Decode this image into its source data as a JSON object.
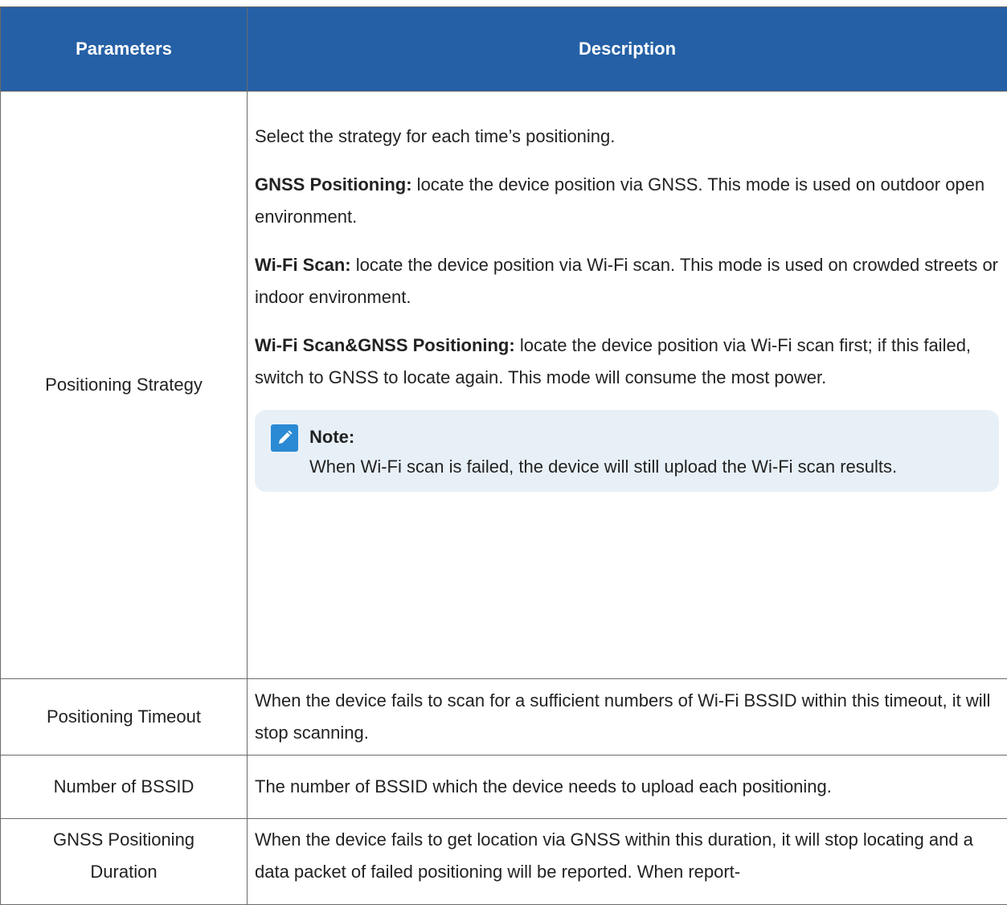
{
  "table": {
    "headers": {
      "parameters": "Parameters",
      "description": "Description"
    },
    "rows": {
      "strategy": {
        "param": "Positioning Strategy",
        "intro": "Select the strategy for each time’s positioning.",
        "gnss_label": "GNSS Positioning:",
        "gnss_text": " locate the device position via GNSS. This mode is used on outdoor open environment.",
        "wifi_label": "Wi-Fi Scan:",
        "wifi_text": " locate the device position via Wi-Fi scan. This mode is used on crowded streets or indoor environment.",
        "combo_label": "Wi-Fi Scan&GNSS Positioning:",
        "combo_text": " locate the device position via Wi-Fi scan first; if this failed, switch to GNSS to locate again. This mode will consume the most power.",
        "note_title": "Note:",
        "note_text": "When Wi-Fi scan is failed, the device will still upload the Wi-Fi scan results.",
        "note_icon": "pencil-icon"
      },
      "timeout": {
        "param": "Positioning Timeout",
        "desc": "When the device fails to scan for a sufficient numbers of Wi-Fi BSSID within this timeout, it will stop scanning."
      },
      "bssid": {
        "param": "Number of BSSID",
        "desc": "The number of BSSID which the device needs to upload each positioning."
      },
      "gnss_duration": {
        "param": "GNSS Positioning Duration",
        "desc": "When the device fails to get location via GNSS within this duration, it will stop locating and a data packet of failed positioning will be reported. When report-"
      }
    }
  },
  "colors": {
    "header_bg": "#2560a6",
    "note_bg": "#e8f0f7",
    "note_icon": "#2a8ad4"
  }
}
